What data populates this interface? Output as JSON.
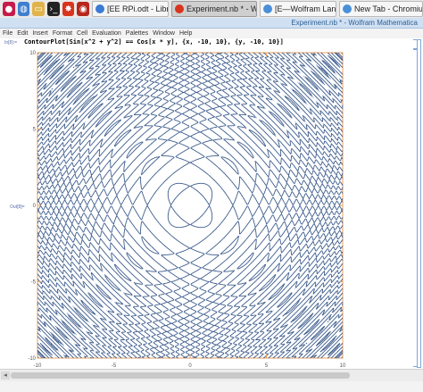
{
  "taskbar": {
    "tasks": [
      {
        "label": "[EE RPi.odt - LibreOf...",
        "icon": "libreoffice-icon",
        "color": "#3a7bd5"
      },
      {
        "label": "Experiment.nb * - Wo...",
        "icon": "mathematica-icon",
        "color": "#d9341e"
      },
      {
        "label": "[E—Wolfram Langua...",
        "icon": "chromium-icon",
        "color": "#4a90d9"
      },
      {
        "label": "New Tab - Chromium",
        "icon": "chromium-icon",
        "color": "#4a90d9"
      }
    ]
  },
  "window": {
    "title": "Experiment.nb * - Wolfram Mathematica"
  },
  "menu": [
    "File",
    "Edit",
    "Insert",
    "Format",
    "Cell",
    "Evaluation",
    "Palettes",
    "Window",
    "Help"
  ],
  "cell": {
    "in_label": "In[8]:=",
    "input": "ContourPlot[Sin[x^2 + y^2] == Cos[x * y], {x, -10, 10}, {y, -10, 10}]",
    "out_label": "Out[8]="
  },
  "chart_data": {
    "type": "contour",
    "equation": "Sin[x^2 + y^2] == Cos[x * y]",
    "xlim": [
      -10,
      10
    ],
    "ylim": [
      -10,
      10
    ],
    "x_ticks": [
      "-10",
      "-5",
      "0",
      "5",
      "10"
    ],
    "y_ticks": [
      "10",
      "5",
      "0",
      "-5",
      "-10"
    ],
    "line_color": "#3b5b8c",
    "frame_color": "#e8a060"
  }
}
